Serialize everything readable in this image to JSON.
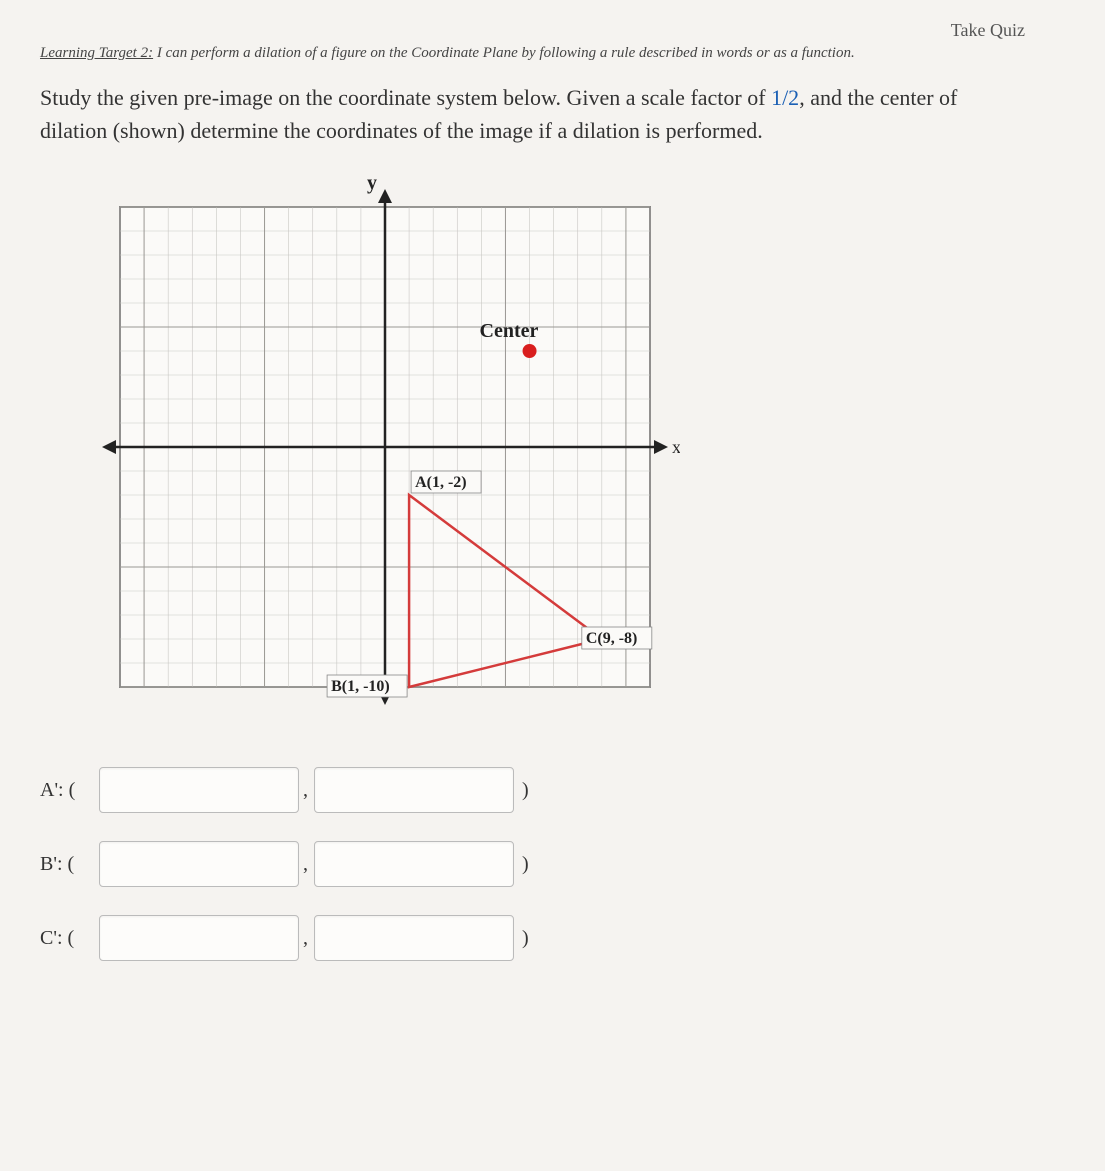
{
  "header_partial": "Take Quiz",
  "learning_target": {
    "label": "Learning Target 2:",
    "text": "I can perform a dilation of a figure on the Coordinate Plane by following a rule described in words or as a function."
  },
  "prompt": {
    "line1a": "Study the given pre-image on the coordinate system below.  Given a scale factor of ",
    "fraction": "1/2",
    "line1b": ", and the center of dilation (shown) determine the coordinates of the image if a dilation is performed."
  },
  "chart_data": {
    "type": "scatter",
    "title": "",
    "xlabel": "x",
    "ylabel": "y",
    "xlim": [
      -11,
      11
    ],
    "ylim": [
      -10,
      10
    ],
    "grid": true,
    "center_label": "Center",
    "center_point": {
      "x": 6,
      "y": 4
    },
    "triangle": [
      {
        "name": "A",
        "label": "A(1, -2)",
        "x": 1,
        "y": -2
      },
      {
        "name": "B",
        "label": "B(1, -10)",
        "x": 1,
        "y": -10
      },
      {
        "name": "C",
        "label": "C(9, -8)",
        "x": 9,
        "y": -8
      }
    ]
  },
  "answers": {
    "rows": [
      {
        "label": "A': ("
      },
      {
        "label": "B': ("
      },
      {
        "label": "C': ("
      }
    ],
    "close_paren": ")"
  }
}
